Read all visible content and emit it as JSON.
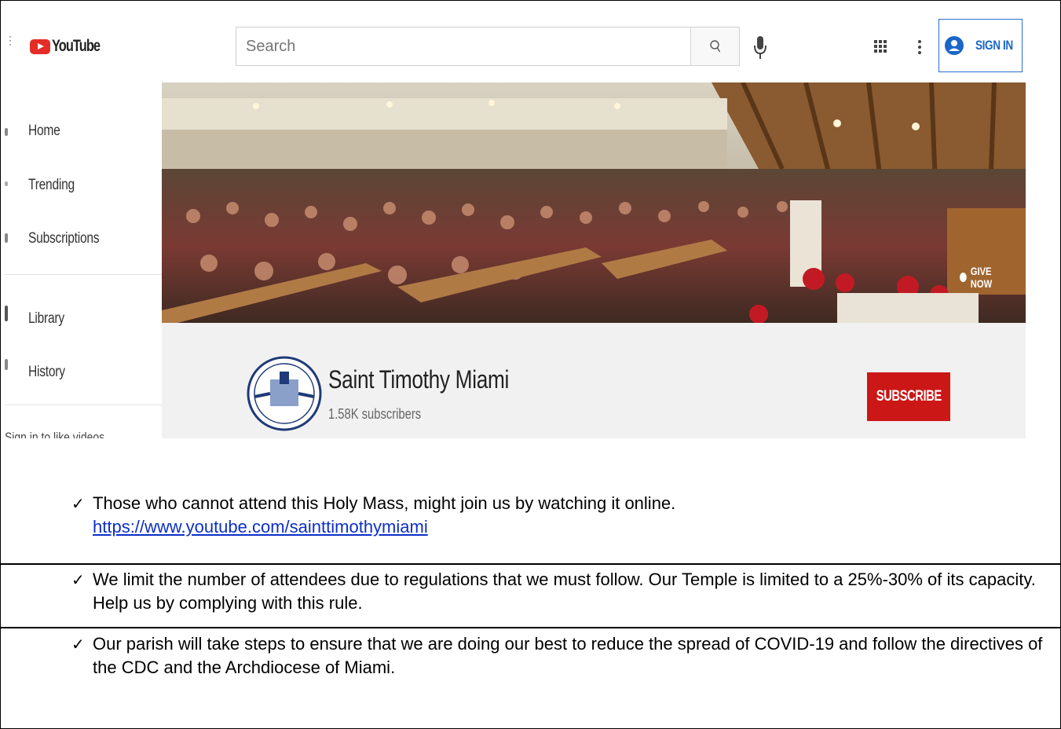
{
  "youtube": {
    "logo_text": "YouTube",
    "search_placeholder": "Search",
    "sign_in_label": "SIGN IN",
    "sidebar": {
      "items": [
        {
          "label": "Home"
        },
        {
          "label": "Trending"
        },
        {
          "label": "Subscriptions"
        },
        {
          "label": "Library"
        },
        {
          "label": "History"
        }
      ],
      "note": "Sign in to like videos"
    },
    "banner": {
      "give_now_label": "GIVE NOW"
    },
    "channel": {
      "name": "Saint Timothy Miami",
      "subscribers": "1.58K subscribers",
      "subscribe_label": "SUBSCRIBE"
    },
    "colors": {
      "brand_red": "#cc1717",
      "sign_in_blue": "#1a66c9"
    }
  },
  "notes": [
    {
      "text": "Those who cannot attend this Holy Mass, might join us by watching it online.",
      "link": "https://www.youtube.com/sainttimothymiami"
    },
    {
      "text": "We limit the number of attendees due to regulations that we must follow. Our Temple is limited to a 25%-30% of its capacity. Help us by complying with this rule."
    },
    {
      "text": "Our parish will take steps to ensure that we are doing our best to reduce the spread of COVID-19 and follow the directives of the CDC and the Archdiocese of Miami."
    }
  ],
  "check_mark": "✓"
}
